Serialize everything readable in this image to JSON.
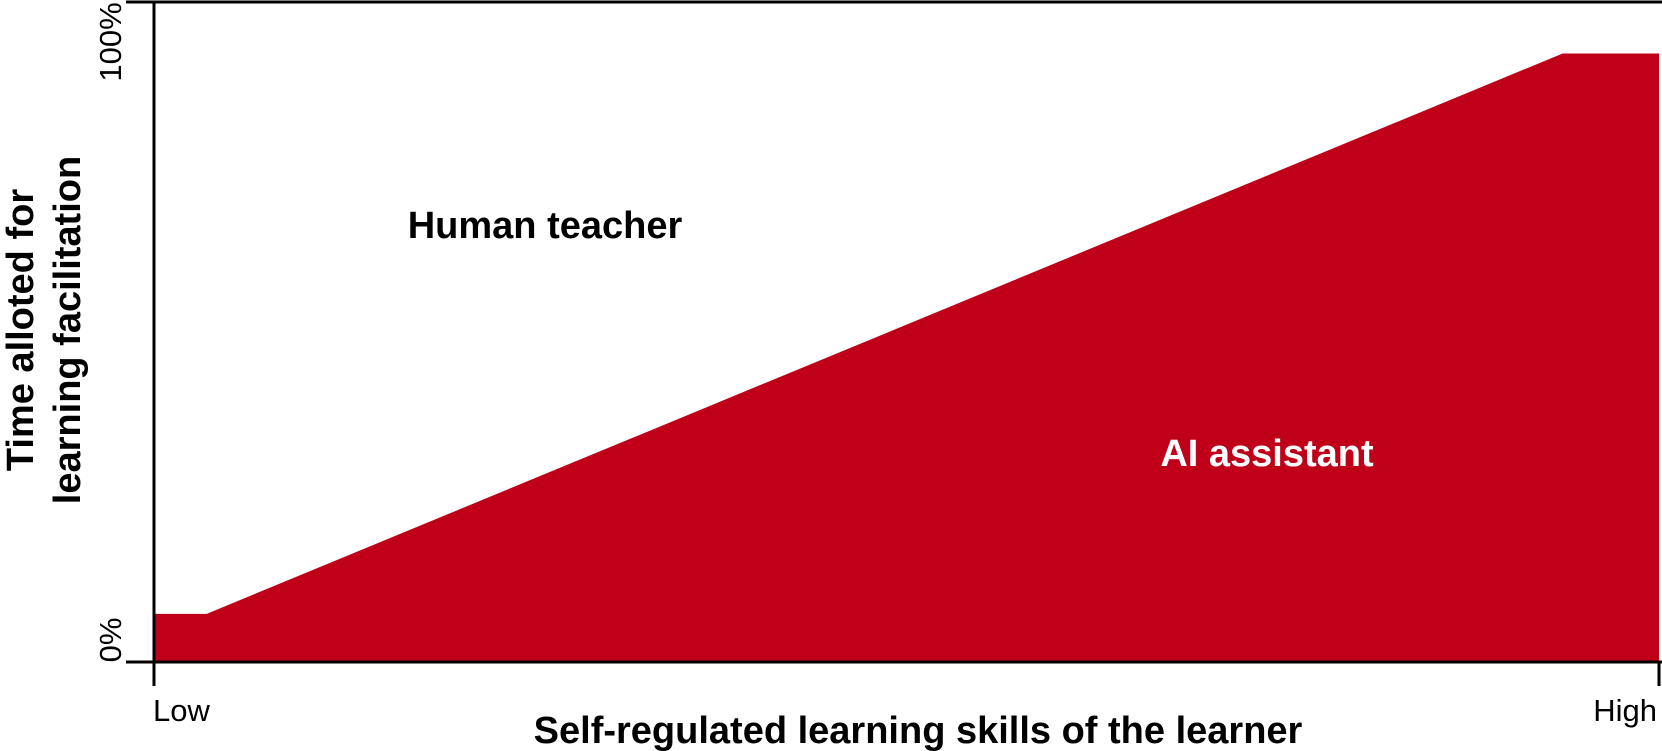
{
  "chart_data": {
    "type": "area",
    "title": "",
    "xlabel": "Self-regulated learning skills of the learner",
    "ylabel_lines": [
      "Time alloted for",
      "learning facilitation"
    ],
    "x_ticks": [
      "Low",
      "High"
    ],
    "y_ticks": [
      "0%",
      "100%"
    ],
    "xlim": [
      0,
      1
    ],
    "ylim": [
      0,
      100
    ],
    "grid": false,
    "series": [
      {
        "name": "AI assistant",
        "color": "#c00018",
        "x": [
          0,
          0.035,
          0.936,
          1
        ],
        "y": [
          7.3,
          7.3,
          92.2,
          92.2
        ]
      },
      {
        "name": "Human teacher",
        "color": "#ffffff",
        "note_fill": "remaining share above AI assistant"
      }
    ],
    "region_labels": {
      "human": "Human teacher",
      "ai": "AI assistant"
    }
  }
}
